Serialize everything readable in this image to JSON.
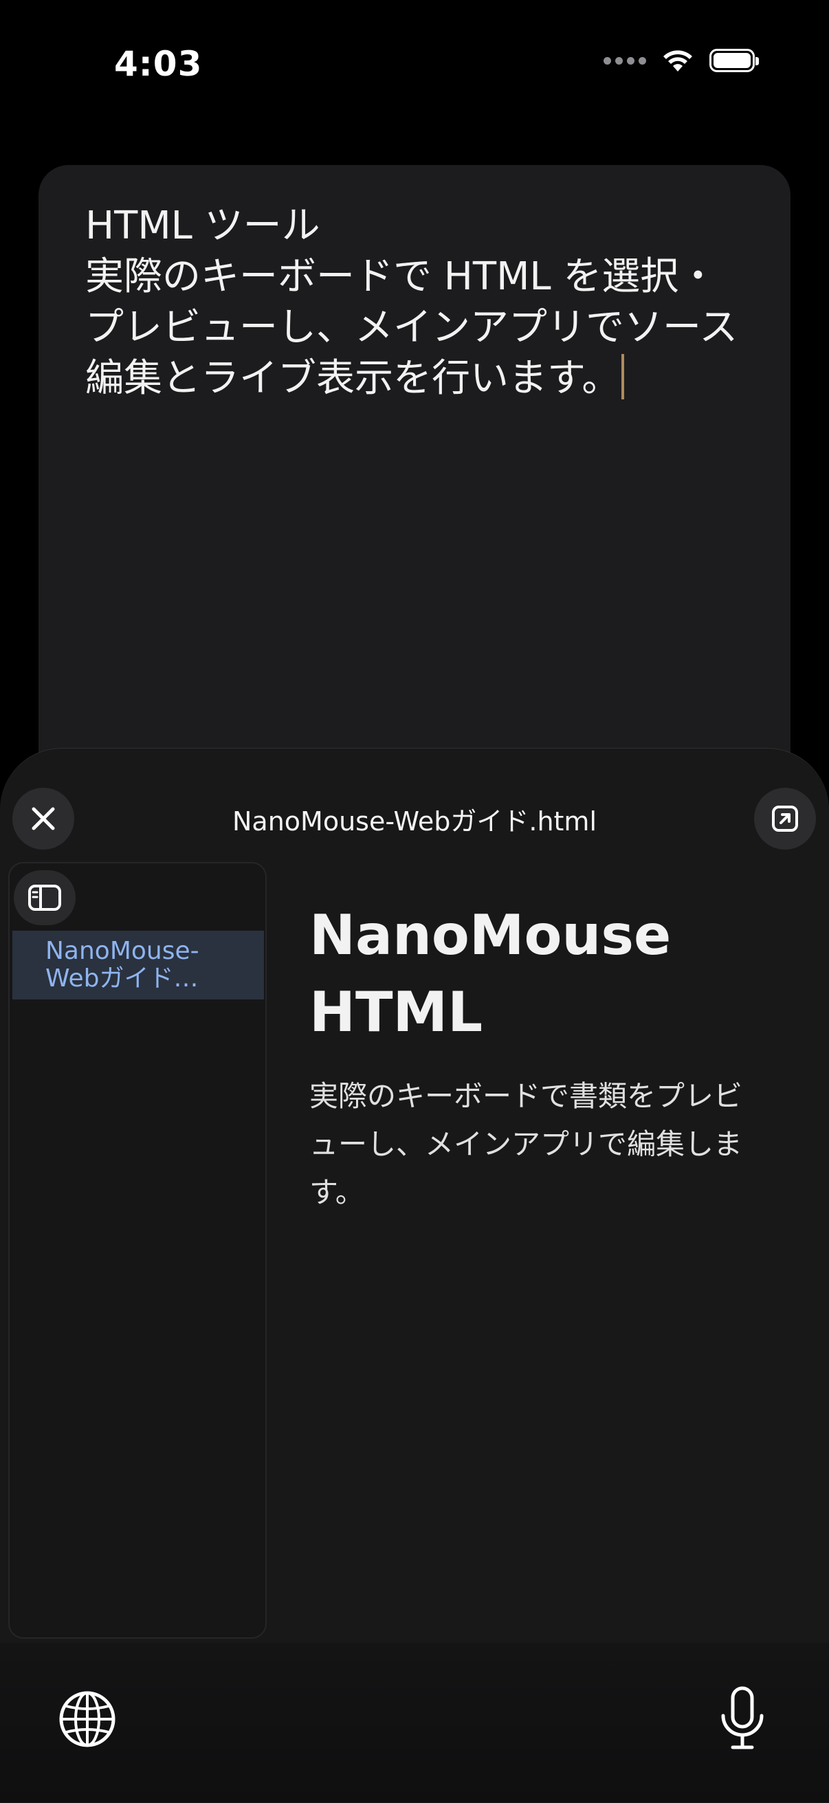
{
  "status_bar": {
    "time": "4:03",
    "icons": [
      "signal-dots-icon",
      "wifi-icon",
      "battery-icon"
    ]
  },
  "host_text": {
    "content": "HTML ツール\n実際のキーボードで HTML を選択・\nプレビューし、メインアプリでソース\n編集とライブ表示を行います。"
  },
  "sheet": {
    "title": "NanoMouse-Webガイド.html",
    "close_icon": "close-icon",
    "expand_icon": "open-external-icon",
    "sidebar": {
      "toggle_icon": "sidebar-toggle-icon",
      "items": [
        {
          "label": "NanoMouse-\nWebガイド…",
          "selected": true
        }
      ]
    },
    "preview": {
      "heading": "NanoMouse\nHTML",
      "body": "実際のキーボードで書類をプレビ\nューし、メインアプリで編集しま\nす。"
    }
  },
  "keyboard_bar": {
    "left_icon": "globe-icon",
    "right_icon": "microphone-icon"
  },
  "colors": {
    "accent_link": "#8fb4ef",
    "selected_bg": "#2a323f",
    "caret": "#b08c5c"
  }
}
